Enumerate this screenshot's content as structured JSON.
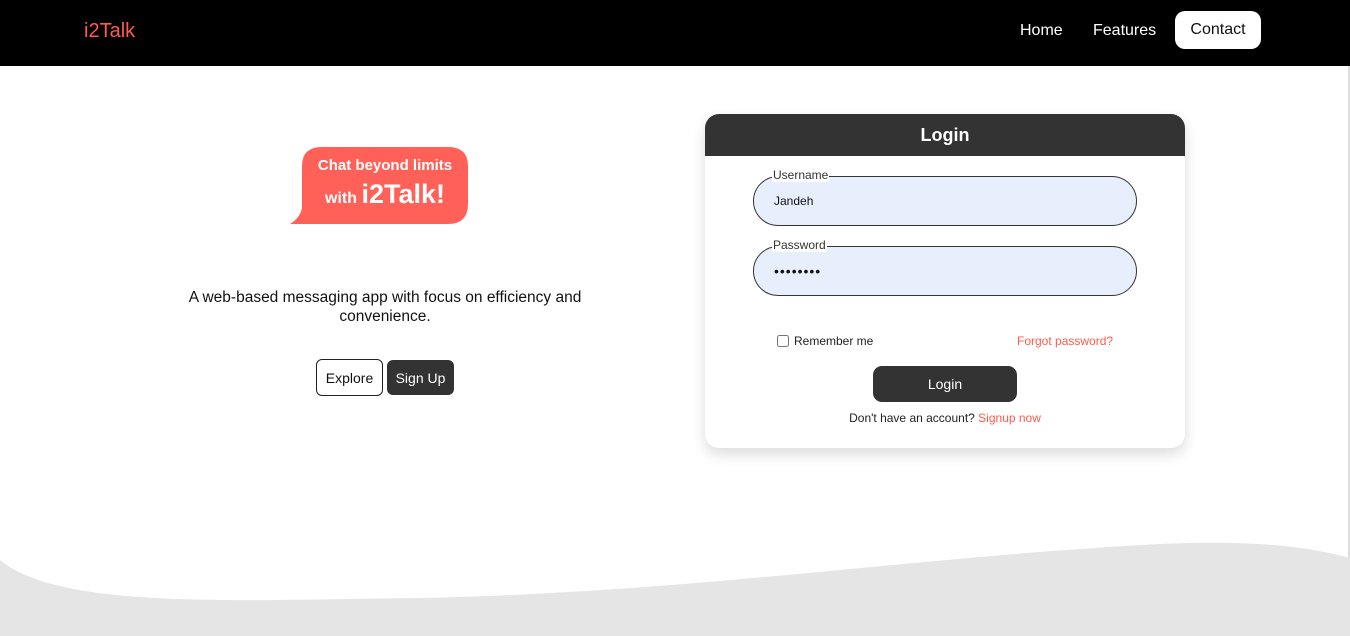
{
  "navbar": {
    "brand": "i2Talk",
    "links": {
      "home": "Home",
      "features": "Features",
      "contact": "Contact"
    }
  },
  "hero": {
    "bubble_line1": "Chat beyond limits",
    "bubble_with": "with",
    "bubble_brand": "i2Talk!",
    "tagline": "A web-based messaging app with focus on efficiency and convenience.",
    "explore_label": "Explore",
    "signup_label": "Sign Up"
  },
  "login": {
    "title": "Login",
    "username_label": "Username",
    "username_value": "Jandeh",
    "password_label": "Password",
    "password_value": "********",
    "remember_label": "Remember me",
    "forgot_label": "Forgot password?",
    "login_button": "Login",
    "no_account_text": "Don't have an account?",
    "signup_link": "Signup now"
  },
  "colors": {
    "accent": "#ff5a4e",
    "dark": "#333333",
    "navbar_bg": "#000000",
    "input_bg": "#e8effc",
    "wave": "#e5e5e5"
  }
}
